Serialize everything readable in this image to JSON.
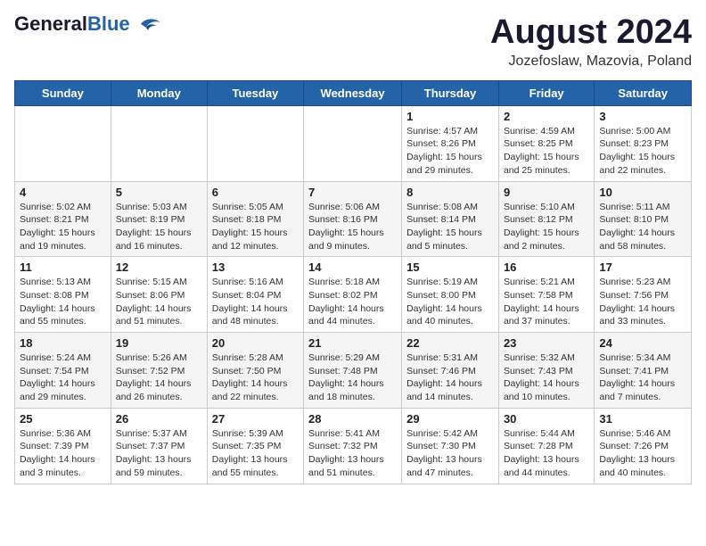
{
  "header": {
    "logo_line1": "General",
    "logo_line2": "Blue",
    "month_year": "August 2024",
    "location": "Jozefoslaw, Mazovia, Poland"
  },
  "weekdays": [
    "Sunday",
    "Monday",
    "Tuesday",
    "Wednesday",
    "Thursday",
    "Friday",
    "Saturday"
  ],
  "weeks": [
    [
      {
        "day": "",
        "info": ""
      },
      {
        "day": "",
        "info": ""
      },
      {
        "day": "",
        "info": ""
      },
      {
        "day": "",
        "info": ""
      },
      {
        "day": "1",
        "info": "Sunrise: 4:57 AM\nSunset: 8:26 PM\nDaylight: 15 hours\nand 29 minutes."
      },
      {
        "day": "2",
        "info": "Sunrise: 4:59 AM\nSunset: 8:25 PM\nDaylight: 15 hours\nand 25 minutes."
      },
      {
        "day": "3",
        "info": "Sunrise: 5:00 AM\nSunset: 8:23 PM\nDaylight: 15 hours\nand 22 minutes."
      }
    ],
    [
      {
        "day": "4",
        "info": "Sunrise: 5:02 AM\nSunset: 8:21 PM\nDaylight: 15 hours\nand 19 minutes."
      },
      {
        "day": "5",
        "info": "Sunrise: 5:03 AM\nSunset: 8:19 PM\nDaylight: 15 hours\nand 16 minutes."
      },
      {
        "day": "6",
        "info": "Sunrise: 5:05 AM\nSunset: 8:18 PM\nDaylight: 15 hours\nand 12 minutes."
      },
      {
        "day": "7",
        "info": "Sunrise: 5:06 AM\nSunset: 8:16 PM\nDaylight: 15 hours\nand 9 minutes."
      },
      {
        "day": "8",
        "info": "Sunrise: 5:08 AM\nSunset: 8:14 PM\nDaylight: 15 hours\nand 5 minutes."
      },
      {
        "day": "9",
        "info": "Sunrise: 5:10 AM\nSunset: 8:12 PM\nDaylight: 15 hours\nand 2 minutes."
      },
      {
        "day": "10",
        "info": "Sunrise: 5:11 AM\nSunset: 8:10 PM\nDaylight: 14 hours\nand 58 minutes."
      }
    ],
    [
      {
        "day": "11",
        "info": "Sunrise: 5:13 AM\nSunset: 8:08 PM\nDaylight: 14 hours\nand 55 minutes."
      },
      {
        "day": "12",
        "info": "Sunrise: 5:15 AM\nSunset: 8:06 PM\nDaylight: 14 hours\nand 51 minutes."
      },
      {
        "day": "13",
        "info": "Sunrise: 5:16 AM\nSunset: 8:04 PM\nDaylight: 14 hours\nand 48 minutes."
      },
      {
        "day": "14",
        "info": "Sunrise: 5:18 AM\nSunset: 8:02 PM\nDaylight: 14 hours\nand 44 minutes."
      },
      {
        "day": "15",
        "info": "Sunrise: 5:19 AM\nSunset: 8:00 PM\nDaylight: 14 hours\nand 40 minutes."
      },
      {
        "day": "16",
        "info": "Sunrise: 5:21 AM\nSunset: 7:58 PM\nDaylight: 14 hours\nand 37 minutes."
      },
      {
        "day": "17",
        "info": "Sunrise: 5:23 AM\nSunset: 7:56 PM\nDaylight: 14 hours\nand 33 minutes."
      }
    ],
    [
      {
        "day": "18",
        "info": "Sunrise: 5:24 AM\nSunset: 7:54 PM\nDaylight: 14 hours\nand 29 minutes."
      },
      {
        "day": "19",
        "info": "Sunrise: 5:26 AM\nSunset: 7:52 PM\nDaylight: 14 hours\nand 26 minutes."
      },
      {
        "day": "20",
        "info": "Sunrise: 5:28 AM\nSunset: 7:50 PM\nDaylight: 14 hours\nand 22 minutes."
      },
      {
        "day": "21",
        "info": "Sunrise: 5:29 AM\nSunset: 7:48 PM\nDaylight: 14 hours\nand 18 minutes."
      },
      {
        "day": "22",
        "info": "Sunrise: 5:31 AM\nSunset: 7:46 PM\nDaylight: 14 hours\nand 14 minutes."
      },
      {
        "day": "23",
        "info": "Sunrise: 5:32 AM\nSunset: 7:43 PM\nDaylight: 14 hours\nand 10 minutes."
      },
      {
        "day": "24",
        "info": "Sunrise: 5:34 AM\nSunset: 7:41 PM\nDaylight: 14 hours\nand 7 minutes."
      }
    ],
    [
      {
        "day": "25",
        "info": "Sunrise: 5:36 AM\nSunset: 7:39 PM\nDaylight: 14 hours\nand 3 minutes."
      },
      {
        "day": "26",
        "info": "Sunrise: 5:37 AM\nSunset: 7:37 PM\nDaylight: 13 hours\nand 59 minutes."
      },
      {
        "day": "27",
        "info": "Sunrise: 5:39 AM\nSunset: 7:35 PM\nDaylight: 13 hours\nand 55 minutes."
      },
      {
        "day": "28",
        "info": "Sunrise: 5:41 AM\nSunset: 7:32 PM\nDaylight: 13 hours\nand 51 minutes."
      },
      {
        "day": "29",
        "info": "Sunrise: 5:42 AM\nSunset: 7:30 PM\nDaylight: 13 hours\nand 47 minutes."
      },
      {
        "day": "30",
        "info": "Sunrise: 5:44 AM\nSunset: 7:28 PM\nDaylight: 13 hours\nand 44 minutes."
      },
      {
        "day": "31",
        "info": "Sunrise: 5:46 AM\nSunset: 7:26 PM\nDaylight: 13 hours\nand 40 minutes."
      }
    ]
  ]
}
